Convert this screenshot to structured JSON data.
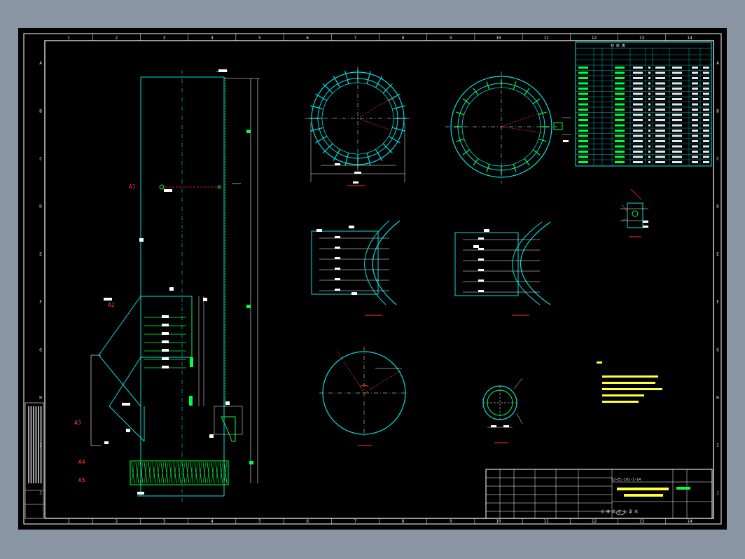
{
  "frame": {
    "col_numbers": [
      "1",
      "2",
      "3",
      "4",
      "5",
      "6",
      "7",
      "8",
      "9",
      "10",
      "11",
      "12",
      "13",
      "14"
    ],
    "row_letters": [
      "A",
      "B",
      "C",
      "D",
      "E",
      "F",
      "G",
      "H",
      "I",
      "J"
    ]
  },
  "bom_table": {
    "title": "材 料 表"
  },
  "title_block": {
    "drawing_no": "SJ-EC-101-1-14",
    "description": "长 度 单 位 为 毫 米"
  },
  "colors": {
    "frame": "#ffffff",
    "steel": "#00e0e0",
    "weld": "#00ff40",
    "dimension": "#ffffff",
    "callout": "#ffff40",
    "marker": "#ff3030"
  }
}
